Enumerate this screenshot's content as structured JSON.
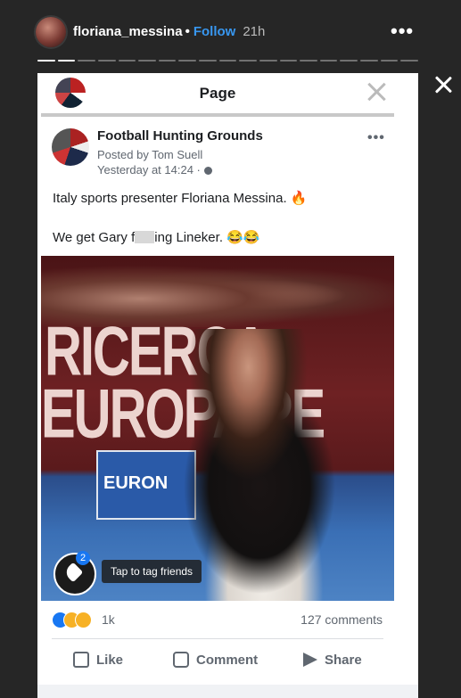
{
  "story": {
    "username": "floriana_messina",
    "separator": "•",
    "follow_label": "Follow",
    "time": "21h",
    "more_label": "•••",
    "segments_total": 19,
    "segments_done": 2
  },
  "page_bar": {
    "title": "Page"
  },
  "post": {
    "page_name": "Football Hunting Grounds",
    "posted_by": "Posted by Tom Suell",
    "timestamp": "Yesterday at 14:24 ·",
    "more_label": "•••",
    "text_line1": "Italy sports presenter Floriana Messina. 🔥",
    "text_line2_a": "We get Gary f",
    "text_line2_b": "ing Lineker. 😂😂",
    "photo_text_1": "RICERCA",
    "photo_text_2": "EUROPA PE",
    "photo_sign": "EURON",
    "tag_badge": "2",
    "tag_tip": "Tap to tag friends"
  },
  "footer": {
    "reaction_count": "1k",
    "comments": "127 comments",
    "like_label": "Like",
    "comment_label": "Comment",
    "share_label": "Share"
  },
  "colors": {
    "background": "#262626",
    "follow": "#3897f0",
    "fb_blue": "#1877f2"
  }
}
